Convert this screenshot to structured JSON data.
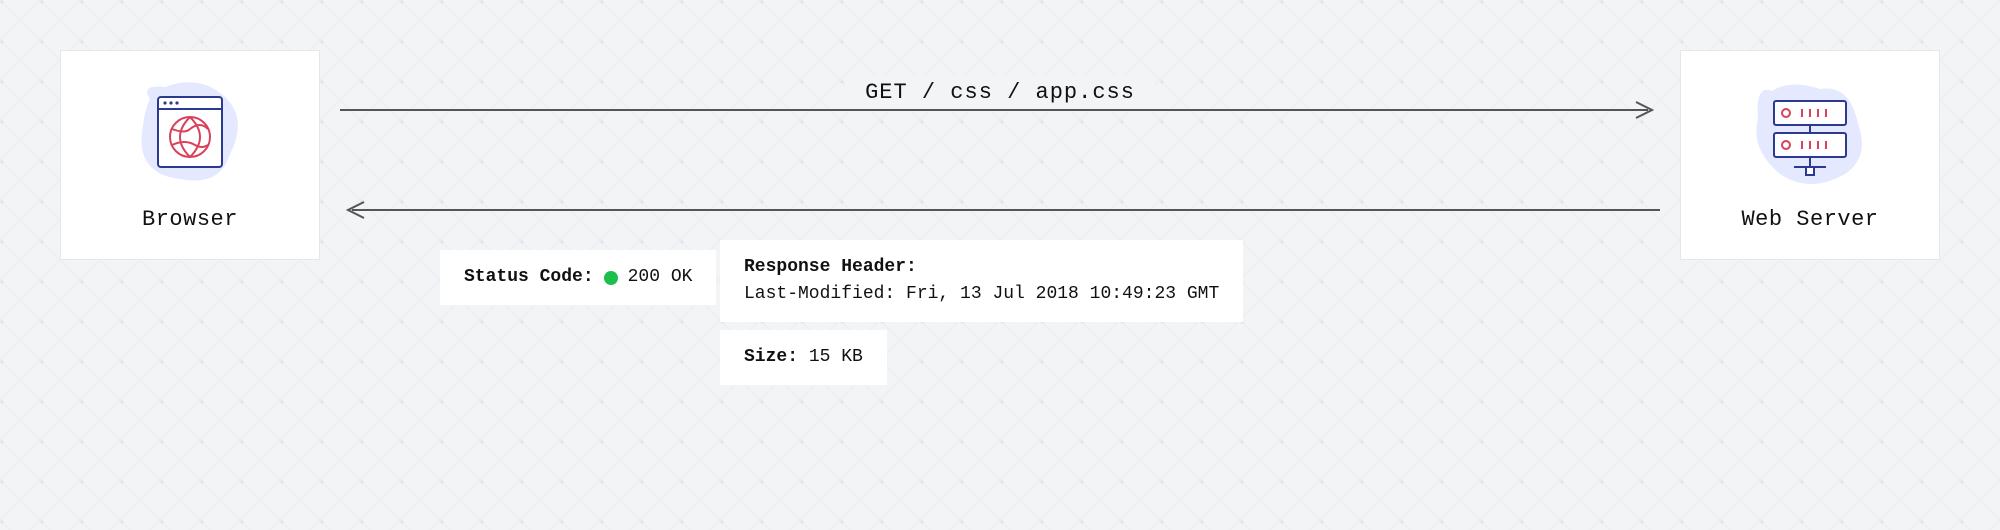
{
  "left_node": {
    "label": "Browser"
  },
  "right_node": {
    "label": "Web Server"
  },
  "request_label": "GET / css / app.css",
  "status": {
    "label": "Status Code:",
    "value": "200 OK",
    "color": "#1bbf4c"
  },
  "response_header": {
    "label": "Response Header:",
    "value": "Last-Modified: Fri, 13 Jul 2018 10:49:23 GMT"
  },
  "size": {
    "label": "Size:",
    "value": "15 KB"
  }
}
